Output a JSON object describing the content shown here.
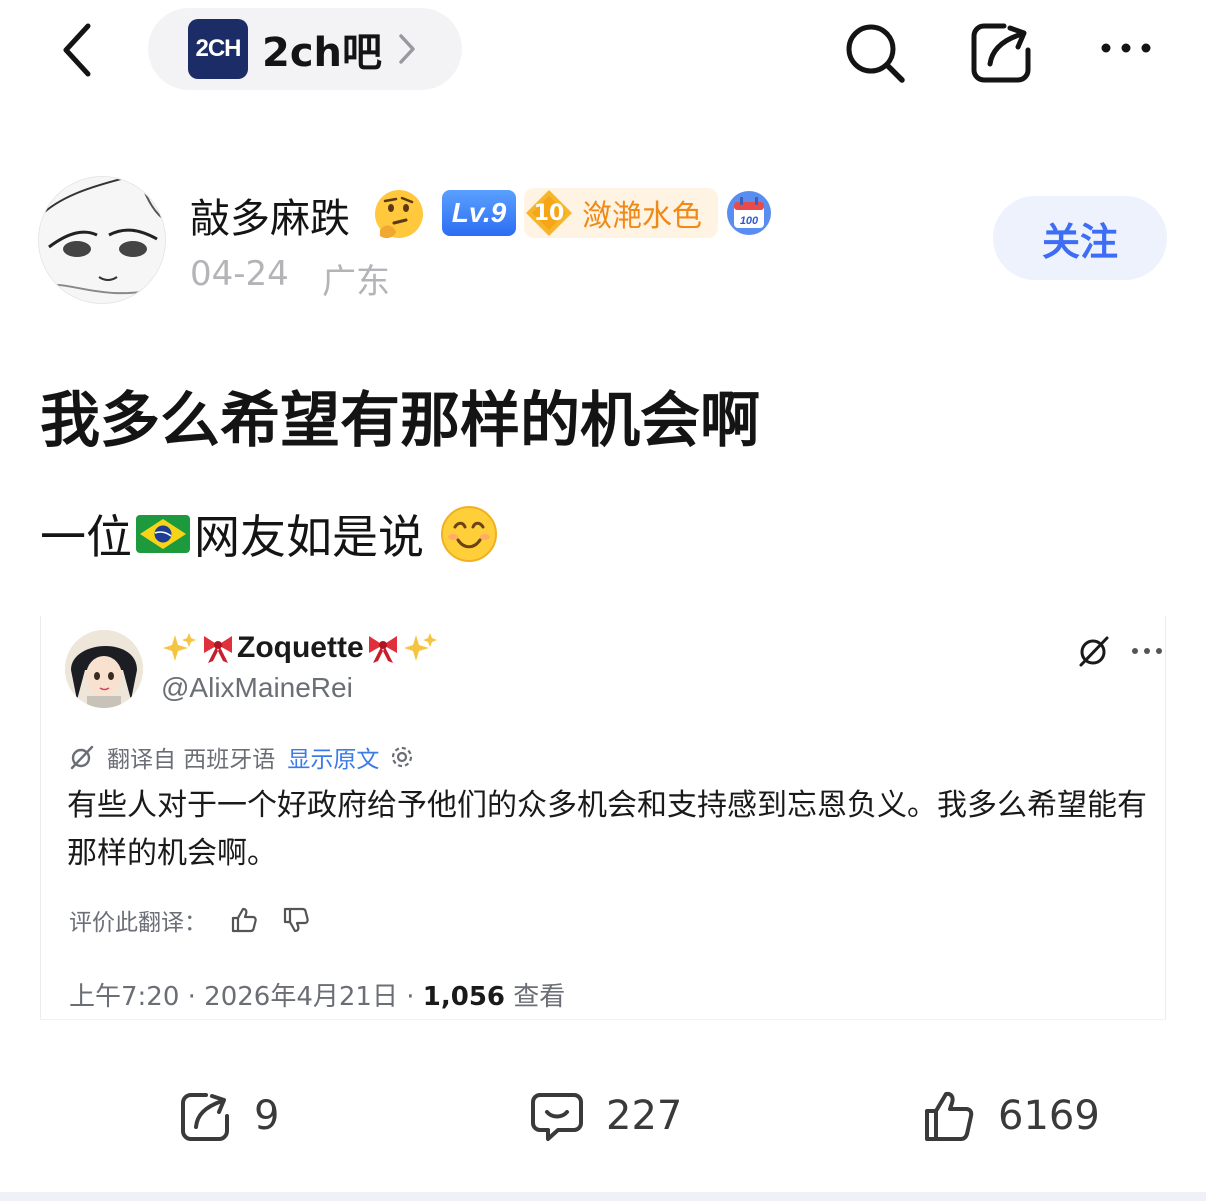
{
  "nav": {
    "forum_name": "2ch吧",
    "forum_logo_text": "2CH"
  },
  "author": {
    "name": "敲多麻跌",
    "level_badge": "Lv.9",
    "fan_level": "10",
    "fan_title": "潋滟水色",
    "calendar_badge": "100",
    "date": "04-24",
    "location": "广东",
    "follow_label": "关注"
  },
  "post": {
    "title": "我多么希望有那样的机会啊",
    "line_prefix": "一位",
    "line_suffix": "网友如是说"
  },
  "embed": {
    "display_name": "Zoquette",
    "handle": "@AlixMaineRei",
    "translated_from": "翻译自 西班牙语",
    "show_original": "显示原文",
    "text": "有些人对于一个好政府给予他们的众多机会和支持感到忘恩负义。我多么希望能有那样的机会啊。",
    "rate_label": "评价此翻译：",
    "meta_prefix": "上午7:20 · 2026年4月21日 · ",
    "views_count": "1,056",
    "views_label": " 查看"
  },
  "actions": {
    "share_count": "9",
    "comment_count": "227",
    "like_count": "6169"
  },
  "colors": {
    "accent": "#3d6cf5",
    "follow_bg": "#eef2fd",
    "fan_title": "#f08a17",
    "link": "#3b7be8"
  }
}
